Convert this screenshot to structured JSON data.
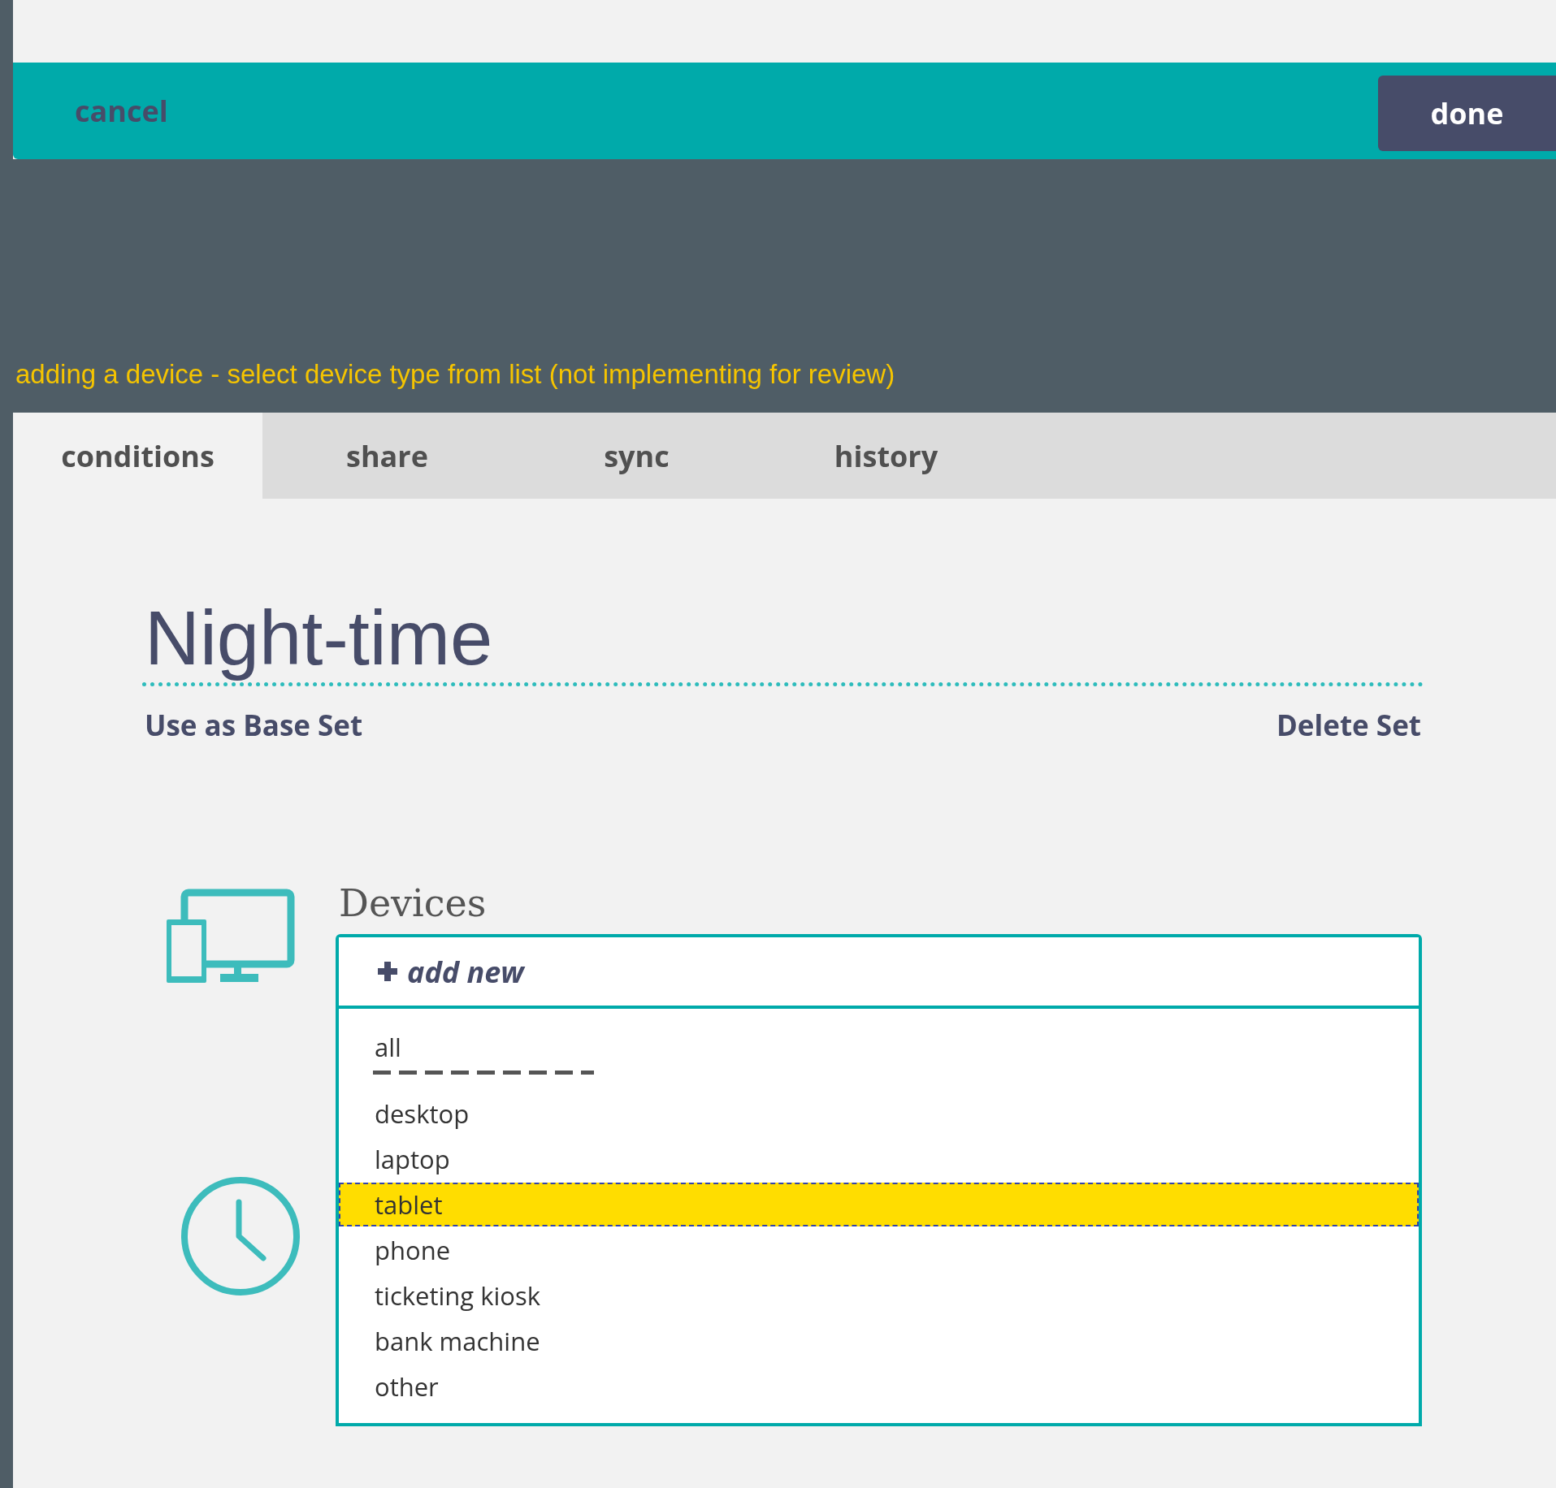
{
  "header": {
    "cancel": "cancel",
    "done": "done"
  },
  "note": "adding a device - select device type from list (not implementing for review)",
  "tabs": [
    {
      "label": "conditions",
      "selected": true
    },
    {
      "label": "share",
      "selected": false
    },
    {
      "label": "sync",
      "selected": false
    },
    {
      "label": "history",
      "selected": false
    }
  ],
  "set": {
    "title": "Night-time",
    "base_action": "Use as Base Set",
    "delete_action": "Delete Set"
  },
  "devices": {
    "heading": "Devices",
    "add_new": "add new",
    "options": [
      {
        "kind": "option",
        "label": "all",
        "selected": false
      },
      {
        "kind": "separator"
      },
      {
        "kind": "option",
        "label": "desktop",
        "selected": false
      },
      {
        "kind": "option",
        "label": "laptop",
        "selected": false
      },
      {
        "kind": "option",
        "label": "tablet",
        "selected": true
      },
      {
        "kind": "option",
        "label": "phone",
        "selected": false
      },
      {
        "kind": "option",
        "label": "ticketing kiosk",
        "selected": false
      },
      {
        "kind": "option",
        "label": "bank machine",
        "selected": false
      },
      {
        "kind": "option",
        "label": "other",
        "selected": false
      }
    ]
  }
}
